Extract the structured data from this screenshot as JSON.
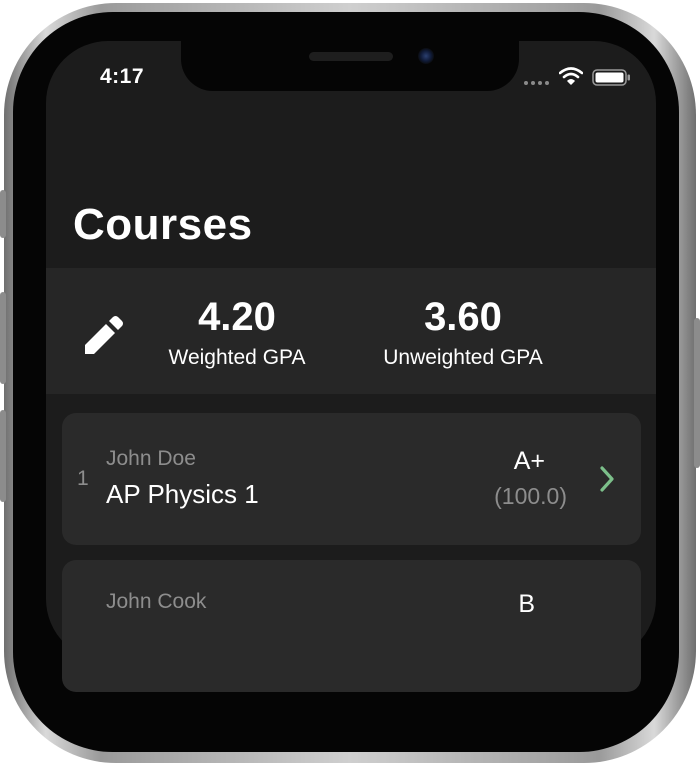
{
  "status_bar": {
    "time": "4:17"
  },
  "page": {
    "title": "Courses"
  },
  "gpa_summary": {
    "weighted_value": "4.20",
    "weighted_label": "Weighted GPA",
    "unweighted_value": "3.60",
    "unweighted_label": "Unweighted GPA"
  },
  "courses": [
    {
      "index": "1",
      "teacher": "John Doe",
      "name": "AP Physics 1",
      "grade": "A+",
      "score": "(100.0)"
    },
    {
      "teacher": "John Cook",
      "grade": "B"
    }
  ],
  "icons": {
    "edit": "pencil-icon",
    "open_course": "chevron-right-icon",
    "wifi": "wifi-icon",
    "battery": "battery-icon",
    "signal": "signal-dots-icon"
  },
  "colors": {
    "background": "#1c1c1c",
    "panel": "#262626",
    "card": "#2a2a2a",
    "text_primary": "#ffffff",
    "text_secondary": "#8d8d8d",
    "accent_chevron": "#7cbf8a"
  }
}
